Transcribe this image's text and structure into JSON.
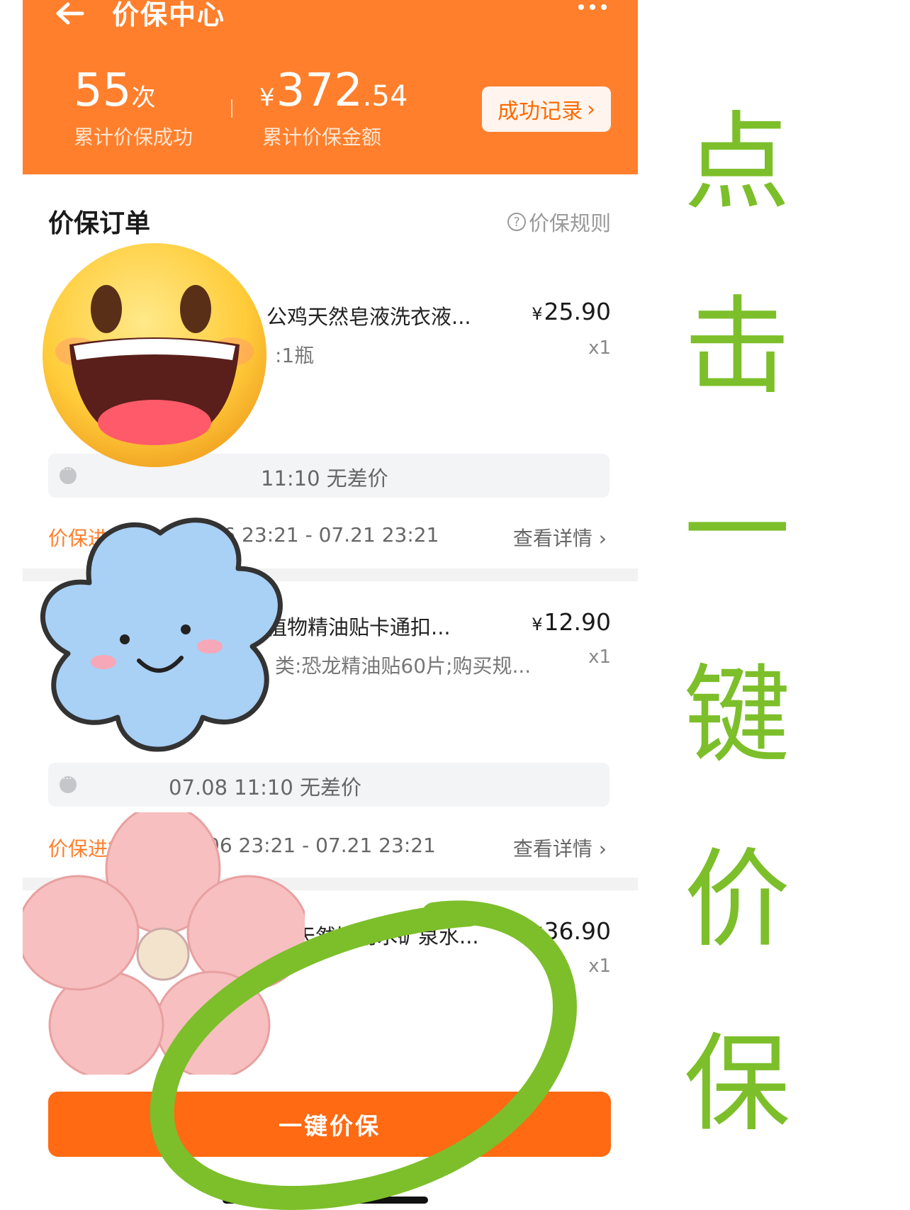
{
  "nav": {
    "title": "价保中心",
    "back_icon": "arrow-left-icon",
    "more_icon": "more-dots-icon"
  },
  "stats": {
    "count": "55",
    "count_unit": "次",
    "count_label": "累计价保成功",
    "amount_symbol": "¥",
    "amount_int": "372",
    "amount_dec": ".54",
    "amount_label": "累计价保金额",
    "record_button": "成功记录"
  },
  "section": {
    "title": "价保订单",
    "rules_label": "价保规则"
  },
  "orders": [
    {
      "name": "公鸡天然皂液洗衣液...",
      "price": "25.90",
      "spec": ":1瓶",
      "qty": "x1",
      "status": "11:10 无差价",
      "progress": "价保进行中",
      "range": "07.06 23:21 - 07.21 23:21",
      "detail": "查看详情"
    },
    {
      "name": "植物精油贴卡通扣...",
      "price": "12.90",
      "spec": "类:恐龙精油贴60片;购买规...",
      "qty": "x1",
      "status": "07.08 11:10 无差价",
      "progress": "价保进行中",
      "range": "06 23:21 - 07.21 23:21",
      "detail": "查看详情"
    },
    {
      "name": "天然饮用水矿泉水...",
      "price": "36.90",
      "qty": "x1"
    }
  ],
  "cta": {
    "label": "一键价保"
  },
  "annotation": {
    "chars": [
      "点",
      "击",
      "一",
      "键",
      "价",
      "保"
    ],
    "color": "#7cbf2a"
  },
  "colors": {
    "brand": "#ff7f2c",
    "cta": "#ff6a13"
  }
}
